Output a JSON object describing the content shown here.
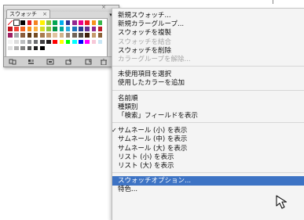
{
  "panel": {
    "tab_label": "スウォッチ",
    "tab_close": "×",
    "window_close": "×",
    "menu_button": "▾≡"
  },
  "menu": {
    "items": [
      {
        "label": "新規スウォッチ...",
        "enabled": true
      },
      {
        "label": "新規カラーグループ...",
        "enabled": true
      },
      {
        "label": "スウォッチを複製",
        "enabled": true
      },
      {
        "label": "スウォッチを結合",
        "enabled": false
      },
      {
        "label": "スウォッチを削除",
        "enabled": true
      },
      {
        "label": "カラーグループを解除...",
        "enabled": false
      },
      {
        "label": "未使用項目を選択",
        "enabled": true
      },
      {
        "label": "使用したカラーを追加",
        "enabled": true
      },
      {
        "label": "名前順",
        "enabled": true
      },
      {
        "label": "種類別",
        "enabled": true
      },
      {
        "label": "「検索」フィールドを表示",
        "enabled": true
      },
      {
        "label": "サムネール (小) を表示",
        "enabled": true,
        "checked": true
      },
      {
        "label": "サムネール (中) を表示",
        "enabled": true
      },
      {
        "label": "サムネール (大) を表示",
        "enabled": true
      },
      {
        "label": "リスト (小) を表示",
        "enabled": true
      },
      {
        "label": "リスト (大) を表示",
        "enabled": true
      },
      {
        "label": "スウォッチオプション...",
        "enabled": true,
        "highlighted": true
      },
      {
        "label": "特色...",
        "enabled": true
      }
    ]
  },
  "colors": {
    "highlight": "#3d73c4",
    "menu_bg": "#f4f4f4",
    "disabled_text": "#a6a6a6"
  },
  "swatch_rows": [
    [
      "#ffffff",
      "#ffffff",
      "#000000",
      "#e41f26",
      "#f58220",
      "#fff200",
      "#8dc63f",
      "#00a651",
      "#00aeef",
      "#2e3192",
      "#92278f",
      "#ec008c",
      "#ed1c24",
      "#f7941d",
      "#39b54a"
    ],
    [
      "#c4161c",
      "#ef4136",
      "#f26522",
      "#f7941d",
      "#fbb040",
      "#d7df23",
      "#8dc63f",
      "#009444",
      "#00a79d",
      "#27aae1",
      "#1c75bc",
      "#2b3990",
      "#662d91",
      "#92278f",
      "#be1e2d"
    ],
    [
      "#9e1f63",
      "#a7a9ac",
      "#8b5e3c",
      "#603913",
      "#754c24",
      "#a97c50",
      "#c49a6c",
      "#e2c39f",
      "#d1b48c",
      "#998675",
      "#736357",
      "#534741",
      "#42210b",
      "#c69c6d",
      "#8c6239"
    ],
    [
      "#f3f3f3",
      "#dcdcdc",
      "#bcbec0",
      "#939598",
      "#6d6e71",
      "#414042",
      "#231f20",
      "#ff0000",
      "#ffff00",
      "#00ff00",
      "#00ffff",
      "#0000ff",
      "#ff00ff",
      "#f7c8d8",
      "#c8e6f5"
    ],
    [
      "#e0e0e0",
      "#b0b0b0",
      "#808080",
      "#505050",
      "#202020",
      "#000000",
      "#ffffff",
      "#ffffff",
      "#ffffff",
      "#ffffff",
      "#ffffff",
      "#ffffff",
      "#ffffff",
      "#ffffff",
      "#ffffff"
    ]
  ]
}
